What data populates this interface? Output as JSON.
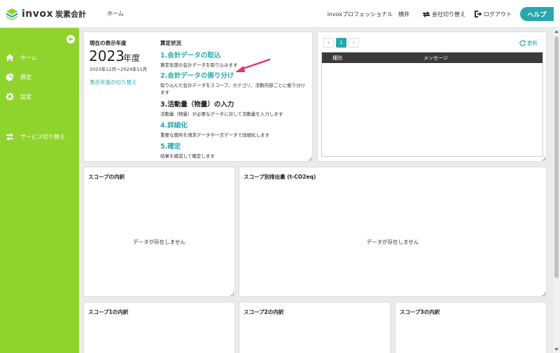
{
  "header": {
    "logo_text": "invox",
    "logo_sub": "炭素会計",
    "nav_home": "ホーム",
    "plan": "invoxプロフェッショナル",
    "user": "横井",
    "switch_company": "会社切り替え",
    "logout": "ログアウト",
    "help": "ヘルプ"
  },
  "sidebar": {
    "items": [
      {
        "label": "ホーム",
        "icon": "home-icon"
      },
      {
        "label": "算定",
        "icon": "pie-chart-icon"
      },
      {
        "label": "設定",
        "icon": "gear-icon"
      },
      {
        "label": "サービス切り替え",
        "icon": "exchange-icon"
      }
    ]
  },
  "year_panel": {
    "label": "現在の表示年度",
    "year": "2023",
    "unit": "年度",
    "range": "2023年12月〜2024年11月",
    "switch_link": "表示年度の切り替え",
    "status_title": "算定状況",
    "steps": [
      {
        "title": "1.会計データの取込",
        "desc": "算定年度の会計データを取り込みます"
      },
      {
        "title": "2.会計データの振り分け",
        "desc": "取り込んだ会計データをスコープ、カテゴリ、活動内容ごとに振り分けます"
      },
      {
        "title": "3.活動量（物量）の入力",
        "desc": "活動量（物量）が必要なデータに対して活動量を入力します"
      },
      {
        "title": "4.詳細化",
        "desc": "重要な箇所を請求データや一次データで詳細化します"
      },
      {
        "title": "5.確定",
        "desc": "結果を確認して確定します"
      }
    ]
  },
  "message_panel": {
    "page": "1",
    "refresh": "更新",
    "col_type": "種別",
    "col_message": "メッセージ"
  },
  "panels": {
    "scope_breakdown": "スコープの内訳",
    "scope_emissions": "スコープ別排出量 (t-CO2eq)",
    "scope1": "スコープ1の内訳",
    "scope2": "スコープ2の内訳",
    "scope3": "スコープ3の内訳",
    "no_data": "データが存在しません"
  },
  "colors": {
    "sidebar": "#8fd42c",
    "accent": "#2aa7ad",
    "arrow": "#e8336d"
  }
}
